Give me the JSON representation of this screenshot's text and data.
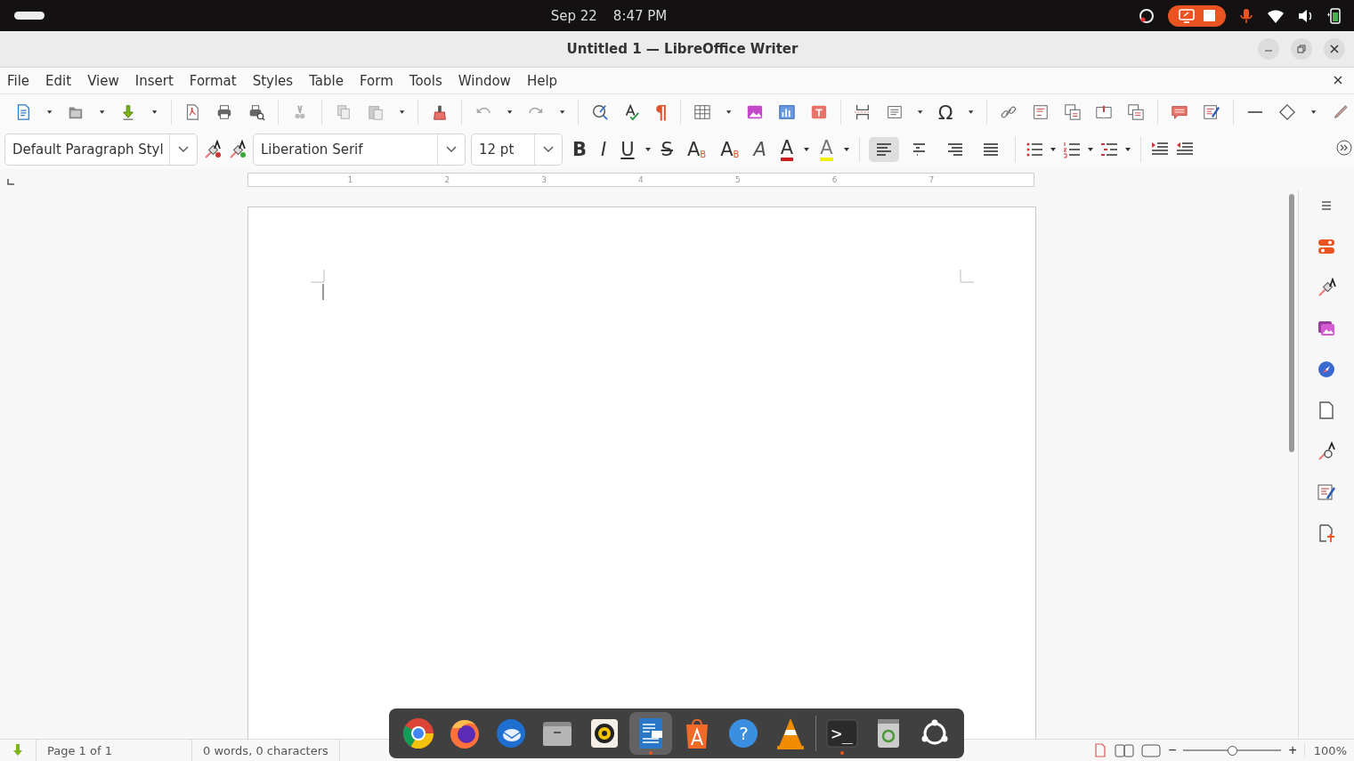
{
  "top_bar": {
    "date": "Sep 22",
    "time": "8:47 PM"
  },
  "window": {
    "title": "Untitled 1 — LibreOffice Writer"
  },
  "menu": [
    "File",
    "Edit",
    "View",
    "Insert",
    "Format",
    "Styles",
    "Table",
    "Form",
    "Tools",
    "Window",
    "Help"
  ],
  "standard_toolbar": {
    "pilcrow": "¶",
    "special_character": "Ω"
  },
  "formatting_toolbar": {
    "paragraph_style": "Default Paragraph Styl",
    "font_name": "Liberation Serif",
    "font_size": "12 pt",
    "character_buttons": [
      {
        "kind": "bold",
        "glyph": "B"
      },
      {
        "kind": "italic",
        "glyph": "I"
      },
      {
        "kind": "underline",
        "glyph": "U"
      },
      {
        "kind": "strike",
        "glyph": "S"
      },
      {
        "kind": "superscript",
        "glyph": "A",
        "index": "B"
      },
      {
        "kind": "subscript",
        "glyph": "A",
        "index": "B"
      },
      {
        "kind": "clear",
        "glyph": "A"
      },
      {
        "kind": "font_color",
        "glyph": "A"
      },
      {
        "kind": "highlight",
        "glyph": "A"
      }
    ],
    "alignment": [
      {
        "selected": true
      },
      {
        "selected": false
      },
      {
        "selected": false
      },
      {
        "selected": false
      }
    ]
  },
  "ruler": {
    "numbers": [
      "1",
      "2",
      "3",
      "4",
      "5",
      "6",
      "7"
    ]
  },
  "status_bar": {
    "page": "Page 1 of 1",
    "words": "0 words, 0 characters",
    "zoom_minus": "−",
    "zoom_plus": "+",
    "zoom": {
      "level": 0.5
    },
    "zoom_reading": "100%"
  },
  "dock": [
    {
      "running": false,
      "selected": false
    },
    {
      "running": false,
      "selected": false
    },
    {
      "running": false,
      "selected": false
    },
    {
      "running": false,
      "selected": false
    },
    {
      "running": false,
      "selected": false
    },
    {
      "running": true,
      "selected": true
    },
    {
      "running": false,
      "selected": false
    },
    {
      "running": false,
      "selected": false,
      "glyph": "?"
    },
    {
      "running": false,
      "selected": false
    },
    {
      "running": true,
      "selected": false,
      "glyph": ">_"
    },
    {
      "running": false,
      "selected": false
    },
    {
      "running": false,
      "selected": false
    }
  ]
}
